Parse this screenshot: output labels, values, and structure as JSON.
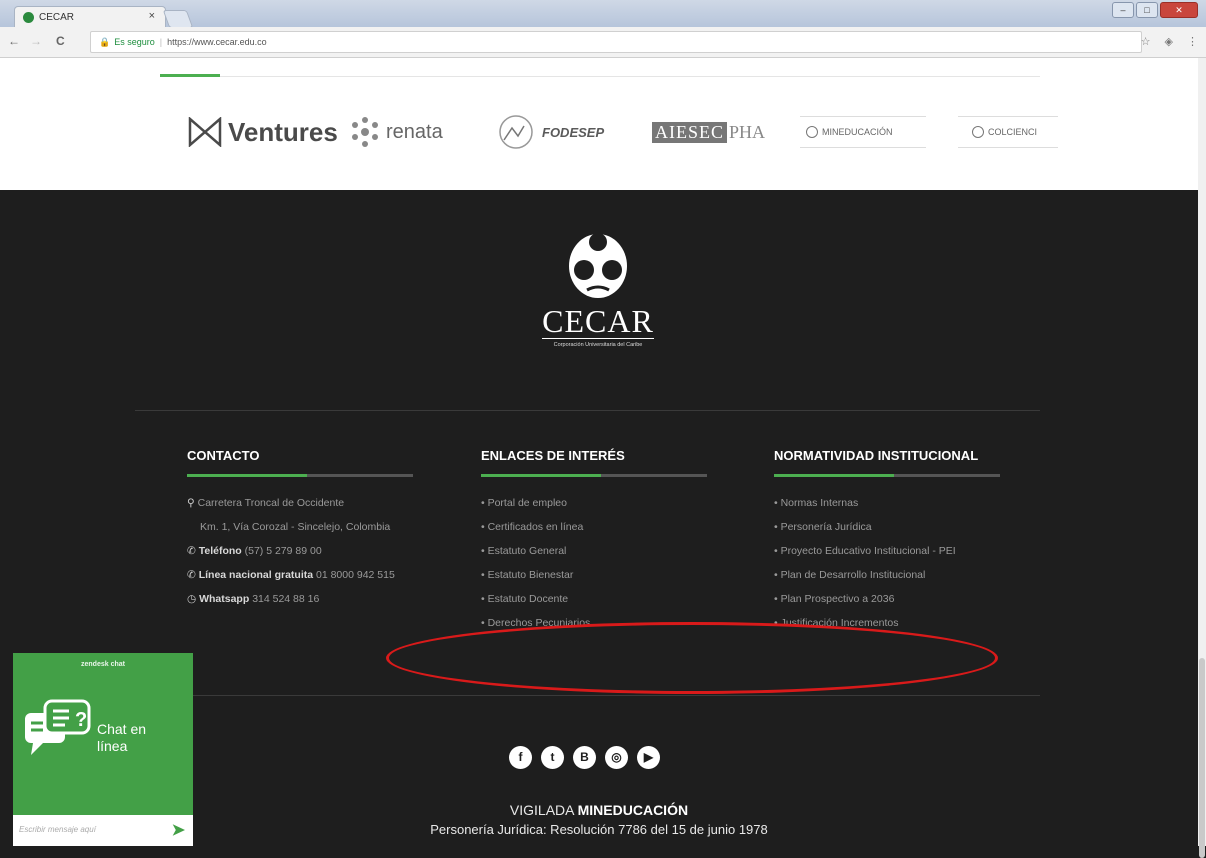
{
  "browser": {
    "tab_title": "CECAR",
    "tab_close": "×",
    "secure_label": "Es seguro",
    "url": "https://www.cecar.edu.co",
    "nav_back": "←",
    "nav_forward": "→",
    "nav_reload": "C",
    "star": "☆",
    "menu": "⋮"
  },
  "partners": {
    "ventures": "Ventures",
    "renata": "renata",
    "fodesep": "FODESEP",
    "aiesec": "AIESEC",
    "aiesec_suffix": "PHA",
    "mineducacion": "MINEDUCACIÓN",
    "colciencias": "COLCIENCI"
  },
  "brand": {
    "name": "CECAR",
    "subtitle": "Corporación Universitaria del Caribe"
  },
  "contacto": {
    "title": "CONTACTO",
    "address1": "Carretera Troncal de Occidente",
    "address2": "Km. 1, Vía Corozal - Sincelejo, Colombia",
    "phone_label": "Teléfono",
    "phone": "(57) 5 279 89 00",
    "national_label": "Línea nacional gratuita",
    "national": "01 8000 942 515",
    "whatsapp_label": "Whatsapp",
    "whatsapp": "314 524 88 16"
  },
  "enlaces": {
    "title": "ENLACES DE INTERÉS",
    "items": [
      "• Portal de empleo",
      "• Certificados en línea",
      "• Estatuto General",
      "• Estatuto Bienestar",
      "• Estatuto Docente",
      "• Derechos Pecuniarios"
    ]
  },
  "normatividad": {
    "title": "NORMATIVIDAD INSTITUCIONAL",
    "items": [
      "• Normas Internas",
      "• Personería Jurídica",
      "• Proyecto Educativo Institucional - PEI",
      "• Plan de Desarrollo Institucional",
      "• Plan Prospectivo a 2036",
      "• Justificación Incrementos"
    ]
  },
  "social": {
    "facebook": "f",
    "twitter": "t",
    "blogger": "B",
    "instagram": "◎",
    "youtube": "▶"
  },
  "footer": {
    "vigilada_prefix": "VIGILADA",
    "vigilada_entity": "MINEDUCACIÓN",
    "personeria": "Personería Jurídica: Resolución 7786 del 15 de junio 1978"
  },
  "chat": {
    "header": "zendesk chat",
    "label_line1": "Chat en",
    "label_line2": "línea",
    "placeholder": "Escribir mensaje aquí",
    "send": "➤"
  },
  "colors": {
    "accent_green": "#4caf50",
    "chat_green": "#43a047",
    "footer_bg": "#1e1e1e",
    "annotation_red": "#d91a1a"
  }
}
